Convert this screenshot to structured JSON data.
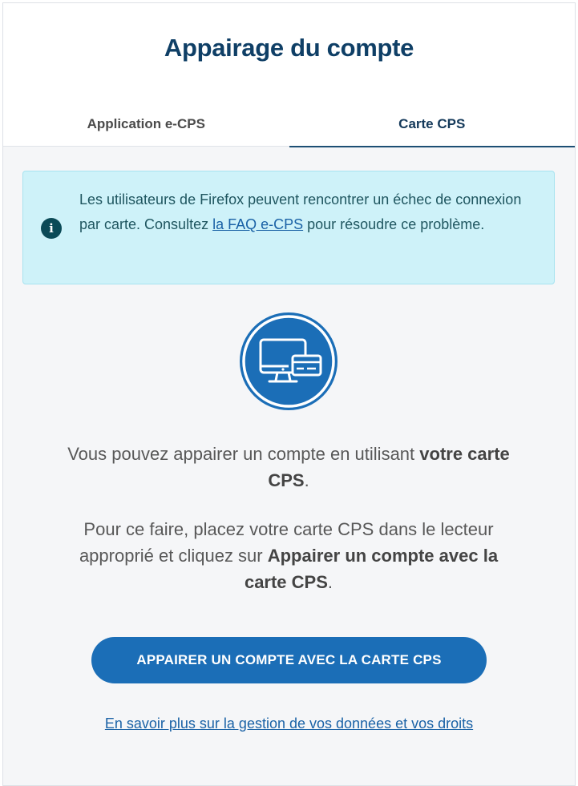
{
  "header": {
    "title": "Appairage du compte",
    "tabs": [
      {
        "label": "Application e-CPS",
        "active": false
      },
      {
        "label": "Carte CPS",
        "active": true
      }
    ]
  },
  "alert": {
    "icon": "info-icon",
    "text_before": "Les utilisateurs de Firefox peuvent rencontrer un échec de connexion par carte. Consultez ",
    "link_text": "la FAQ e-CPS",
    "text_after": " pour résoudre ce problème."
  },
  "hero": {
    "icon": "computer-card-icon"
  },
  "paragraph1": {
    "text": "Vous pouvez appairer un compte en utilisant ",
    "bold": "votre carte CPS",
    "end": "."
  },
  "paragraph2": {
    "text": "Pour ce faire, placez votre carte CPS dans le lecteur approprié et cliquez sur ",
    "bold": "Appairer un compte avec la carte CPS",
    "end": "."
  },
  "cta_label": "APPAIRER UN COMPTE AVEC LA CARTE CPS",
  "learn_more": "En savoir plus sur la gestion de vos données et vos droits",
  "colors": {
    "title": "#0f3f66",
    "primary": "#1b6eb7",
    "alert_bg": "#cef2f9",
    "link": "#1a62a6"
  }
}
